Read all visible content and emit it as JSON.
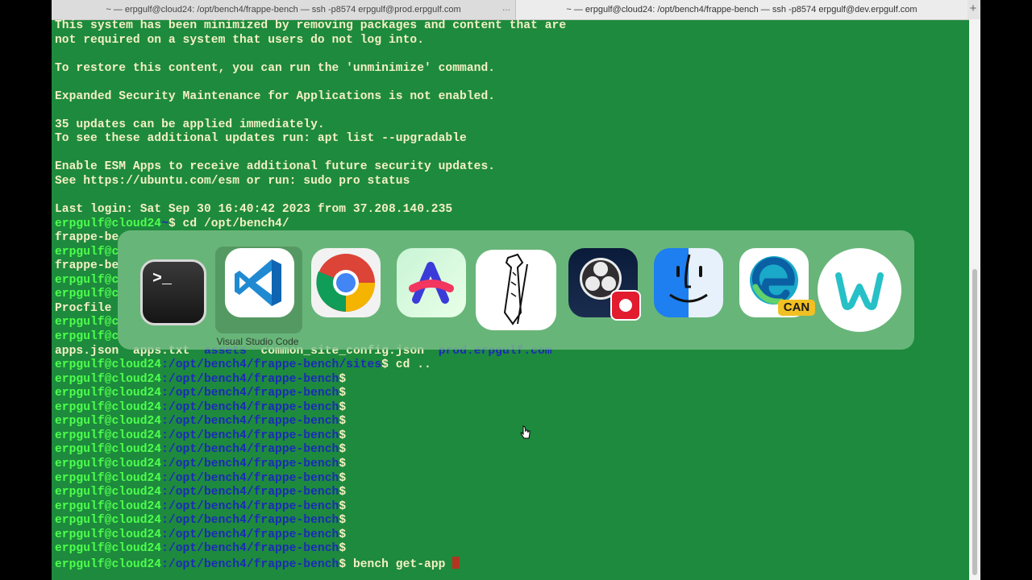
{
  "tabs": [
    {
      "label": "~ — erpgulf@cloud24: /opt/bench4/frappe-bench — ssh -p8574 erpgulf@prod.erpgulf.com"
    },
    {
      "label": "~ — erpgulf@cloud24: /opt/bench4/frappe-bench — ssh -p8574 erpgulf@dev.erpgulf.com"
    }
  ],
  "tab_more": "...",
  "new_tab": "+",
  "terminal": {
    "motd": [
      "This system has been minimized by removing packages and content that are",
      "not required on a system that users do not log into.",
      "",
      "To restore this content, you can run the 'unminimize' command.",
      "",
      "Expanded Security Maintenance for Applications is not enabled.",
      "",
      "35 updates can be applied immediately.",
      "To see these additional updates run: apt list --upgradable",
      "",
      "Enable ESM Apps to receive additional future security updates.",
      "See https://ubuntu.com/esm or run: sudo pro status",
      "",
      "Last login: Sat Sep 30 16:40:42 2023 from 37.208.140.235"
    ],
    "user": "erpgulf@cloud24",
    "cd_line": {
      "path": "~",
      "cmd": "$ cd /opt/bench4/"
    },
    "partial_lines": [
      {
        "kind": "text",
        "text": "frappe-be"
      },
      {
        "kind": "user",
        "text": "erpgulf@c"
      },
      {
        "kind": "text",
        "text": "frappe-be"
      },
      {
        "kind": "user",
        "text": "erpgulf@c"
      },
      {
        "kind": "user",
        "text": "erpgulf@c"
      },
      {
        "kind": "text",
        "text": "Procfile"
      },
      {
        "kind": "user",
        "text": "erpgulf@c"
      },
      {
        "kind": "user",
        "text": "erpgulf@c"
      }
    ],
    "ls_line": {
      "a": "apps.json",
      "b": "apps.txt",
      "c": "assets",
      "d": "common_site_config.json",
      "e": "prod.erpgulf.com"
    },
    "sites_line": {
      "path": ":/opt/bench4/frappe-bench/sites",
      "cmd": "$ cd .."
    },
    "bench_path": ":/opt/bench4/frappe-bench",
    "prompt_sym": "$",
    "empty_prompt_count": 13,
    "last_cmd": "$ bench get-app "
  },
  "switcher": {
    "selected_label": "Visual Studio Code",
    "terminal_glyph": ">_",
    "edge_badge": "CAN",
    "apps": [
      "Terminal",
      "Visual Studio Code",
      "Google Chrome",
      "Arc",
      "Tie app",
      "OBS Studio",
      "Finder",
      "Microsoft Edge Canary",
      "W app"
    ]
  },
  "colors": {
    "terminal_bg": "#1e8a3d",
    "text": "#f4f1c4",
    "user": "#4dff4d",
    "path": "#1b2bb8",
    "cursor": "#b3341f"
  }
}
